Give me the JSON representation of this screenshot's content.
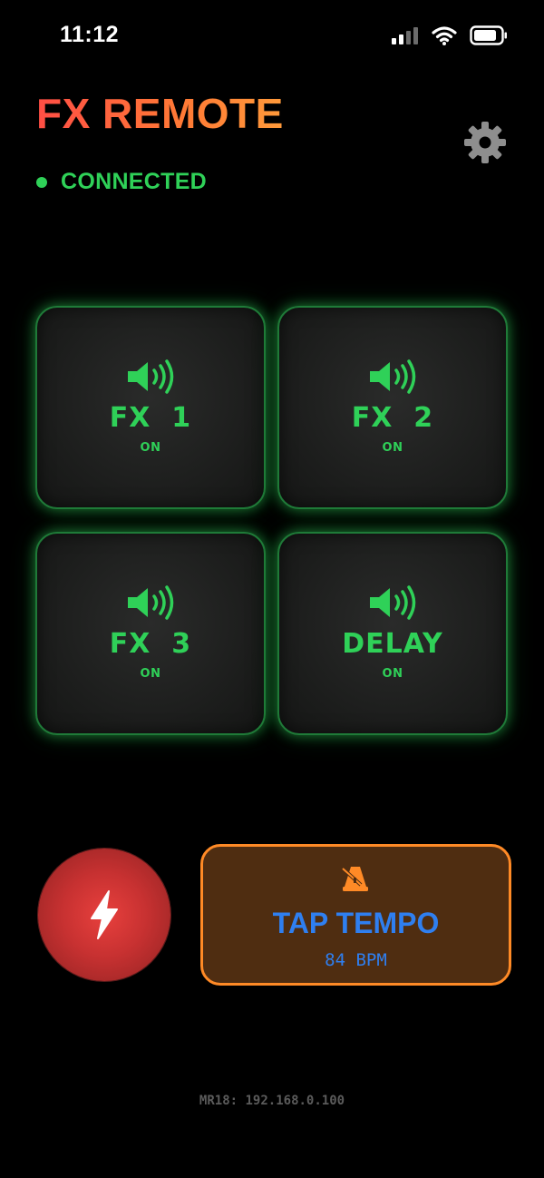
{
  "status_bar": {
    "time": "11:12"
  },
  "header": {
    "title": "FX REMOTE",
    "connection_status": "CONNECTED"
  },
  "pads": [
    {
      "label": "FX  1",
      "state": "ON"
    },
    {
      "label": "FX  2",
      "state": "ON"
    },
    {
      "label": "FX  3",
      "state": "ON"
    },
    {
      "label": "DELAY",
      "state": "ON"
    }
  ],
  "tap_tempo": {
    "label": "TAP TEMPO",
    "bpm": "84  BPM"
  },
  "footer": {
    "device": "MR18: 192.168.0.100"
  },
  "colors": {
    "accent_green": "#2fd158",
    "title_gradient_start": "#ff4e45",
    "title_gradient_end": "#ff9a3a",
    "tap_border": "#ff8a26",
    "tap_fill": "#4f2d11",
    "tap_text": "#2f7ff0",
    "bolt_red": "#c73131"
  },
  "icons": {
    "settings": "gear-icon",
    "pad": "speaker-icon",
    "bolt": "lightning-icon",
    "tap": "metronome-icon"
  }
}
